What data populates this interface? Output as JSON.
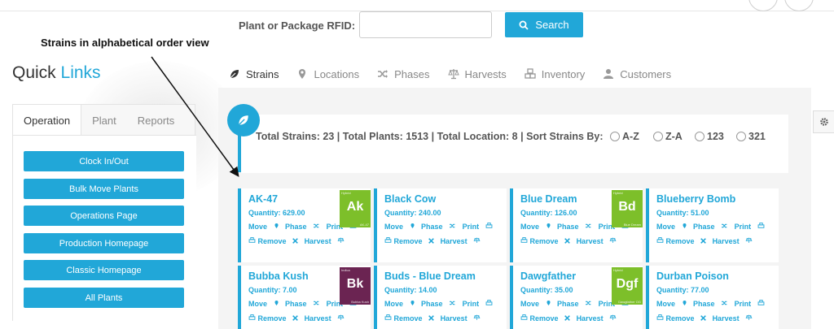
{
  "rfid": {
    "label": "Plant or Package RFID:",
    "value": "",
    "placeholder": ""
  },
  "search": {
    "label": "Search",
    "icon": "search-icon"
  },
  "annotation": "Strains in alphabetical order view",
  "quick_links": {
    "title_a": "Quick ",
    "title_b": "Links",
    "tabs": [
      "Operation",
      "Plant",
      "Reports"
    ],
    "buttons": [
      "Clock In/Out",
      "Bulk Move Plants",
      "Operations Page",
      "Production Homepage",
      "Classic Homepage",
      "All Plants"
    ]
  },
  "tabs": [
    {
      "label": "Strains",
      "icon": "leaf-icon"
    },
    {
      "label": "Locations",
      "icon": "map-pin-icon"
    },
    {
      "label": "Phases",
      "icon": "shuffle-icon"
    },
    {
      "label": "Harvests",
      "icon": "scale-icon"
    },
    {
      "label": "Inventory",
      "icon": "cubes-icon"
    },
    {
      "label": "Customers",
      "icon": "user-icon"
    }
  ],
  "summary": {
    "text": "Total Strains: 23 | Total Plants: 1513 | Total Location: 8 | Sort Strains By:",
    "sort_options": [
      "A-Z",
      "Z-A",
      "123",
      "321"
    ]
  },
  "card_labels": {
    "move": "Move",
    "phase": "Phase",
    "print": "Print",
    "remove": "Remove",
    "harvest": "Harvest"
  },
  "colors": {
    "accent": "#21a7d8",
    "hybrid_tile": "#7dbf2a",
    "indica_tile": "#6b2452"
  },
  "strains": [
    {
      "name": "AK-47",
      "quantity": "Quantity: 629.00",
      "tile": {
        "abbr": "Ak",
        "type": "Hybrid",
        "name": "AK-47"
      }
    },
    {
      "name": "Black Cow",
      "quantity": "Quantity: 240.00"
    },
    {
      "name": "Blue Dream",
      "quantity": "Quantity: 126.00",
      "tile": {
        "abbr": "Bd",
        "type": "Hybrid",
        "name": "Blue Dream"
      }
    },
    {
      "name": "Blueberry Bomb",
      "quantity": "Quantity: 51.00"
    },
    {
      "name": "Bubba Kush",
      "quantity": "Quantity: 7.00",
      "tile": {
        "abbr": "Bk",
        "type": "Indica",
        "name": "Bubba Kush"
      }
    },
    {
      "name": "Buds - Blue Dream",
      "quantity": "Quantity: 14.00"
    },
    {
      "name": "Dawgfather",
      "quantity": "Quantity: 35.00",
      "tile": {
        "abbr": "Dgf",
        "type": "Hybrid",
        "name": "Dawgfather OG"
      }
    },
    {
      "name": "Durban Poison",
      "quantity": "Quantity: 77.00"
    }
  ]
}
